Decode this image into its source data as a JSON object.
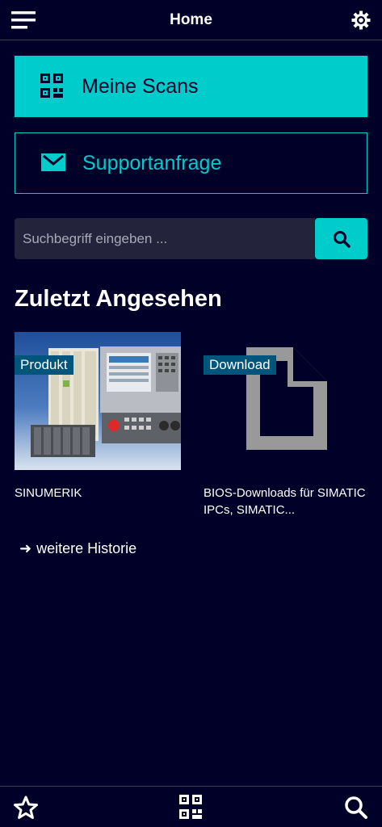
{
  "header": {
    "title": "Home",
    "menu_icon": "hamburger-menu-icon",
    "settings_icon": "gear-icon"
  },
  "actions": {
    "scans_label": "Meine Scans",
    "scans_icon": "qr-code-icon",
    "support_label": "Supportanfrage",
    "support_icon": "envelope-icon"
  },
  "search": {
    "placeholder": "Suchbegriff eingeben ...",
    "value": "",
    "button_icon": "search-icon"
  },
  "recent": {
    "title": "Zuletzt Angesehen",
    "items": [
      {
        "badge": "Produkt",
        "title": "SINUMERIK",
        "image": "cnc-product-image"
      },
      {
        "badge": "Download",
        "title": "BIOS-Downloads für SIMATIC IPCs, SIMATIC...",
        "image": "document-icon"
      }
    ],
    "more_label": "weitere Historie",
    "more_icon": "arrow-right-icon"
  },
  "bottom_nav": {
    "favorites_icon": "star-icon",
    "scan_icon": "qr-code-icon",
    "search_icon": "search-icon"
  },
  "colors": {
    "background": "#000028",
    "accent": "#00cccc",
    "input_bg": "#23233c",
    "badge_bg": "#00557c",
    "doc_gray": "#999999"
  }
}
